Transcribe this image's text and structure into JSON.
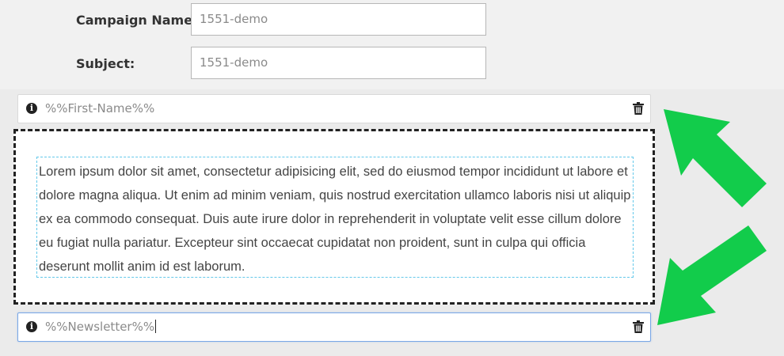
{
  "form": {
    "campaign_name_label": "Campaign Name:",
    "campaign_name_value": "1551-demo",
    "subject_label": "Subject:",
    "subject_value": "1551-demo"
  },
  "blocks": [
    {
      "token": "%%First-Name%%",
      "focused": false
    },
    {
      "token": "%%Newsletter%%",
      "focused": true
    }
  ],
  "text_block": {
    "body": "Lorem ipsum dolor sit amet, consectetur adipisicing elit, sed do eiusmod tempor incididunt ut labore et dolore magna aliqua. Ut enim ad minim veniam, quis nostrud exercitation ullamco laboris nisi ut aliquip ex ea commodo consequat. Duis aute irure dolor in reprehenderit in voluptate velit esse cillum dolore eu fugiat nulla pariatur. Excepteur sint occaecat cupidatat non proident, sunt in culpa qui officia deserunt mollit anim id est laborum."
  },
  "icons": {
    "info": "info-icon",
    "trash": "trash-icon",
    "annotation_arrow": "arrow-icon"
  },
  "colors": {
    "arrow_green": "#12cc4b",
    "focus_border": "#7aa7e6",
    "text_block_border": "#64c8ea"
  }
}
